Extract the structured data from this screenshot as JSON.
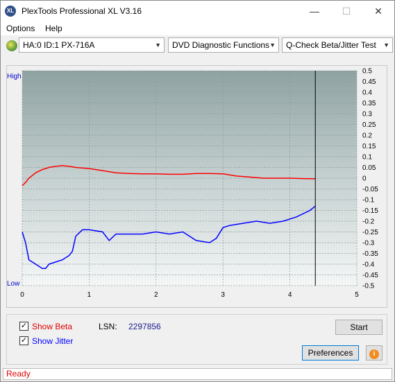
{
  "window": {
    "title": "PlexTools Professional XL V3.16",
    "icon_text": "XL"
  },
  "menu": {
    "options": "Options",
    "help": "Help"
  },
  "toolbar": {
    "drive": "HA:0 ID:1  PX-716A",
    "function": "DVD Diagnostic Functions",
    "test": "Q-Check Beta/Jitter Test"
  },
  "chart_data": {
    "type": "line",
    "left_axis_labels": {
      "top": "High",
      "bottom": "Low"
    },
    "x_ticks": [
      "0",
      "1",
      "2",
      "3",
      "4",
      "5"
    ],
    "xlim": [
      0,
      5
    ],
    "y_ticks": [
      "0.5",
      "0.45",
      "0.4",
      "0.35",
      "0.3",
      "0.25",
      "0.2",
      "0.15",
      "0.1",
      "0.05",
      "0",
      "-0.05",
      "-0.1",
      "-0.15",
      "-0.2",
      "-0.25",
      "-0.3",
      "-0.35",
      "-0.4",
      "-0.45",
      "-0.5"
    ],
    "ylim": [
      -0.5,
      0.5
    ],
    "grid": true,
    "end_marker_x": 4.38,
    "series": [
      {
        "color": "#ff0000",
        "x": [
          0,
          0.05,
          0.1,
          0.2,
          0.3,
          0.4,
          0.5,
          0.6,
          0.7,
          0.8,
          1.0,
          1.2,
          1.4,
          1.6,
          1.8,
          2.0,
          2.2,
          2.4,
          2.6,
          2.8,
          3.0,
          3.2,
          3.4,
          3.6,
          3.8,
          4.0,
          4.2,
          4.38
        ],
        "y": [
          -0.035,
          -0.02,
          0.0,
          0.025,
          0.04,
          0.05,
          0.055,
          0.058,
          0.055,
          0.05,
          0.045,
          0.035,
          0.025,
          0.022,
          0.02,
          0.02,
          0.018,
          0.018,
          0.022,
          0.022,
          0.02,
          0.01,
          0.005,
          0.0,
          0.0,
          0.0,
          -0.002,
          -0.003
        ]
      },
      {
        "color": "#0000ff",
        "x": [
          0,
          0.05,
          0.1,
          0.2,
          0.3,
          0.35,
          0.4,
          0.5,
          0.6,
          0.7,
          0.75,
          0.8,
          0.9,
          1.0,
          1.2,
          1.3,
          1.4,
          1.6,
          1.8,
          2.0,
          2.2,
          2.4,
          2.6,
          2.8,
          2.9,
          3.0,
          3.1,
          3.3,
          3.5,
          3.7,
          3.9,
          4.1,
          4.3,
          4.38
        ],
        "y": [
          -0.25,
          -0.3,
          -0.38,
          -0.4,
          -0.42,
          -0.42,
          -0.4,
          -0.39,
          -0.38,
          -0.36,
          -0.34,
          -0.27,
          -0.24,
          -0.24,
          -0.25,
          -0.29,
          -0.26,
          -0.26,
          -0.26,
          -0.25,
          -0.26,
          -0.25,
          -0.29,
          -0.3,
          -0.28,
          -0.23,
          -0.22,
          -0.21,
          -0.2,
          -0.21,
          -0.2,
          -0.18,
          -0.15,
          -0.13
        ]
      }
    ]
  },
  "options": {
    "show_beta": "Show Beta",
    "show_jitter": "Show Jitter",
    "beta_checked": "✓",
    "jitter_checked": "✓"
  },
  "lsn": {
    "label": "LSN:",
    "value": "2297856"
  },
  "buttons": {
    "start": "Start",
    "preferences": "Preferences",
    "info_glyph": "i"
  },
  "status": "Ready",
  "colors": {
    "beta": "#e00000",
    "jitter": "#0000ff",
    "accent_orange": "#f28c1f"
  }
}
